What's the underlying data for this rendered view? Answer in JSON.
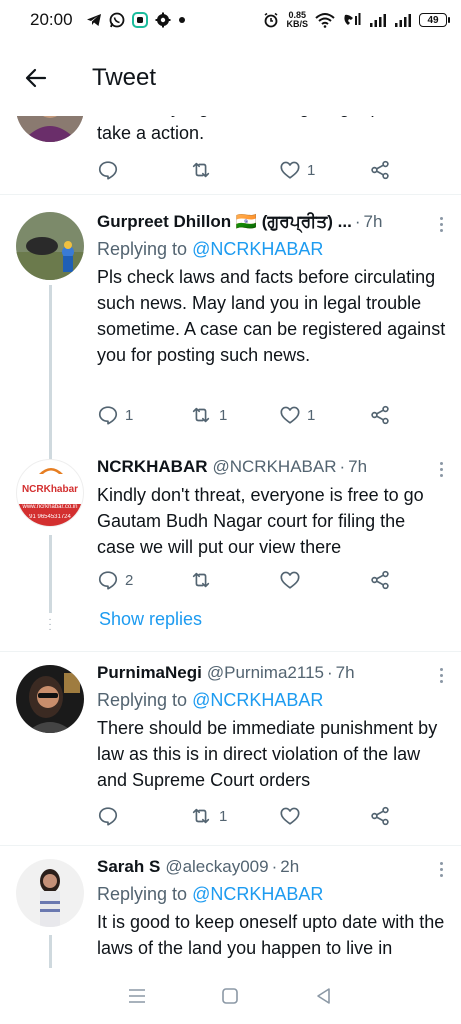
{
  "status_bar": {
    "time": "20:00",
    "speed_value": "0.85",
    "speed_unit": "KB/S",
    "battery": "49",
    "left_icons": [
      "telegram-icon",
      "whatsapp-icon",
      "app-icon",
      "settings-gear-icon",
      "dot-icon"
    ],
    "right_icons": [
      "alarm-icon",
      "wifi-icon",
      "volte-icon",
      "signal-icon",
      "signal-icon"
    ]
  },
  "header": {
    "title": "Tweet"
  },
  "partial_tweet": {
    "text_top": "Absolutely, right 👏 @umgbhagar please",
    "text": "take a action.",
    "like_count": "1"
  },
  "tweets": [
    {
      "name": "Gurpreet Dhillon 🇮🇳 (ਗੁਰਪ੍ਰੀਤ) ...",
      "handle": "",
      "time": "7h",
      "reply_prefix": "Replying to ",
      "reply_to": "@NCRKHABAR",
      "text": "Pls check laws and facts before circulating such news. May land you in legal trouble sometime. A case can be registered against you for posting such news.",
      "reply_count": "1",
      "retweet_count": "1",
      "like_count": "1"
    },
    {
      "name": "NCRKHABAR",
      "handle": "@NCRKHABAR",
      "time": "7h",
      "text": "Kindly don't threat, everyone is free to go Gautam Budh Nagar court for filing the case we will put our view there",
      "reply_count": "2",
      "retweet_count": "",
      "like_count": "",
      "show_replies": "Show replies",
      "avatar_logo": "NCRKhabar",
      "avatar_url": "www.ncrkhabar.co.in",
      "avatar_phone": "91 9654531724"
    },
    {
      "name": "PurnimaNegi",
      "handle": "@Purnima2115",
      "time": "7h",
      "reply_prefix": "Replying to ",
      "reply_to": "@NCRKHABAR",
      "text": "There should be immediate punishment by law as this is in direct violation of the law and Supreme Court orders",
      "reply_count": "",
      "retweet_count": "1",
      "like_count": ""
    },
    {
      "name": "Sarah S",
      "handle": "@aleckay009",
      "time": "2h",
      "reply_prefix": "Replying to ",
      "reply_to": "@NCRKHABAR",
      "text": "It is good to keep oneself upto date with the laws of the land you happen to live in"
    }
  ],
  "nav_bar": {
    "icons": [
      "recents-icon",
      "home-icon",
      "back-triangle-icon"
    ]
  },
  "colors": {
    "accent": "#1d9bf0",
    "text": "#0f1419",
    "secondary": "#536471",
    "divider": "#eff3f4"
  }
}
